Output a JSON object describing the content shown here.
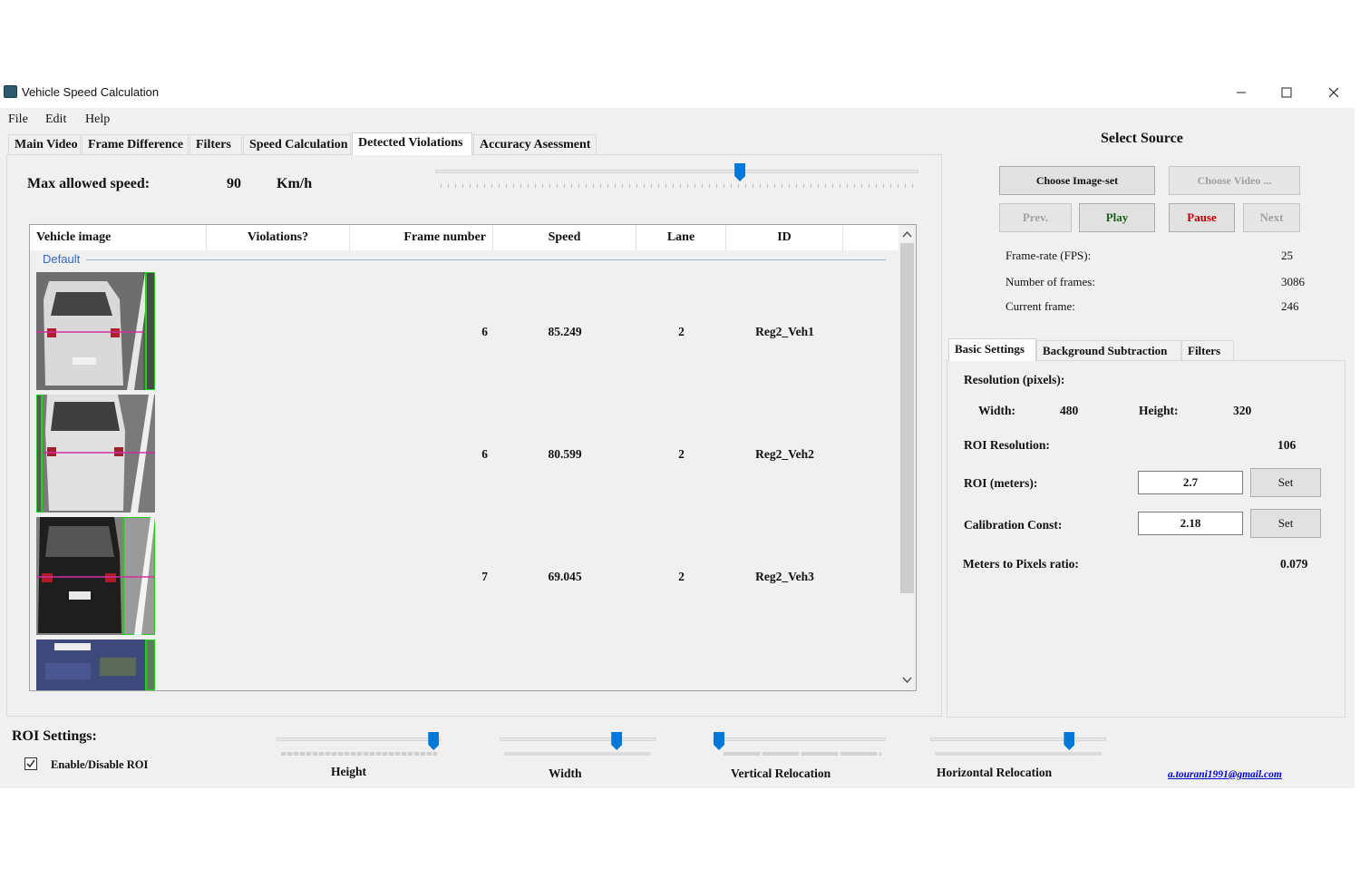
{
  "window": {
    "title": "Vehicle Speed Calculation"
  },
  "menu": [
    "File",
    "Edit",
    "Help"
  ],
  "main_tabs": [
    "Main Video",
    "Frame Difference",
    "Filters",
    "Speed Calculation",
    "Detected Violations",
    "Accuracy Asessment"
  ],
  "violations": {
    "max_speed_label": "Max allowed speed:",
    "max_speed_value": "90",
    "max_speed_unit": "Km/h",
    "slider_fraction": 0.63,
    "columns": [
      "Vehicle image",
      "Violations?",
      "Frame number",
      "Speed",
      "Lane",
      "ID"
    ],
    "group_label": "Default",
    "rows": [
      {
        "frame": "6",
        "speed": "85.249",
        "lane": "2",
        "id": "Reg2_Veh1"
      },
      {
        "frame": "6",
        "speed": "80.599",
        "lane": "2",
        "id": "Reg2_Veh2"
      },
      {
        "frame": "7",
        "speed": "69.045",
        "lane": "2",
        "id": "Reg2_Veh3"
      }
    ]
  },
  "source": {
    "title": "Select Source",
    "choose_imageset": "Choose Image-set",
    "choose_video": "Choose Video ...",
    "prev": "Prev.",
    "play": "Play",
    "pause": "Pause",
    "next": "Next",
    "framerate_label": "Frame-rate (FPS):",
    "framerate_value": "25",
    "num_frames_label": "Number of frames:",
    "num_frames_value": "3086",
    "current_frame_label": "Current frame:",
    "current_frame_value": "246"
  },
  "settings_tabs": [
    "Basic Settings",
    "Background Subtraction",
    "Filters"
  ],
  "basic": {
    "resolution_label": "Resolution (pixels):",
    "width_label": "Width:",
    "width_value": "480",
    "height_label": "Height:",
    "height_value": "320",
    "roi_res_label": "ROI Resolution:",
    "roi_res_value": "106",
    "roi_meters_label": "ROI (meters):",
    "roi_meters_value": "2.7",
    "calib_label": "Calibration Const:",
    "calib_value": "2.18",
    "set_label": "Set",
    "ratio_label": "Meters to Pixels ratio:",
    "ratio_value": "0.079"
  },
  "roi": {
    "title": "ROI Settings:",
    "enable_label": "Enable/Disable ROI",
    "enabled": true,
    "height_label": "Height",
    "width_label": "Width",
    "vertical_label": "Vertical Relocation",
    "horizontal_label": "Horizontal Relocation",
    "height_fraction": 0.99,
    "width_fraction": 0.77,
    "vertical_fraction": 0.0,
    "horizontal_fraction": 0.81
  },
  "email": "a.tourani1991@gmail.com",
  "colors": {
    "accent": "#0078d7",
    "pause_text": "#c00000",
    "play_text": "#1a5e1a",
    "link": "#0000cc",
    "group": "#3366cc"
  }
}
